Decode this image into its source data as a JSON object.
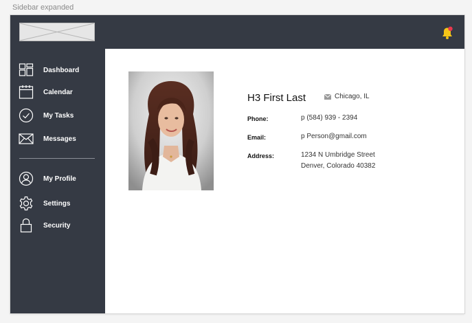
{
  "caption": "Sidebar expanded",
  "colors": {
    "sidebar_bg": "#353a44",
    "accent_bell": "#f5c518",
    "notification": "#e8384f"
  },
  "header": {
    "logo_icon": "logo-placeholder-icon",
    "notification_icon": "bell-icon"
  },
  "sidebar": {
    "items": [
      {
        "label": "Dashboard",
        "icon": "dashboard-icon"
      },
      {
        "label": "Calendar",
        "icon": "calendar-icon"
      },
      {
        "label": "My Tasks",
        "icon": "check-circle-icon"
      },
      {
        "label": "Messages",
        "icon": "envelope-icon"
      },
      {
        "label": "My Profile",
        "icon": "user-icon"
      },
      {
        "label": "Settings",
        "icon": "gear-icon"
      },
      {
        "label": "Security",
        "icon": "lock-icon"
      }
    ]
  },
  "profile": {
    "name": "H3 First Last",
    "location": "Chicago, IL",
    "location_icon": "envelope-icon",
    "fields": {
      "phone_label": "Phone:",
      "phone_value": "p (584) 939 - 2394",
      "email_label": "Email:",
      "email_value": "p Person@gmail.com",
      "address_label": "Address:",
      "address_line1": "1234 N Umbridge Street",
      "address_line2": "Denver, Colorado 40382"
    }
  }
}
